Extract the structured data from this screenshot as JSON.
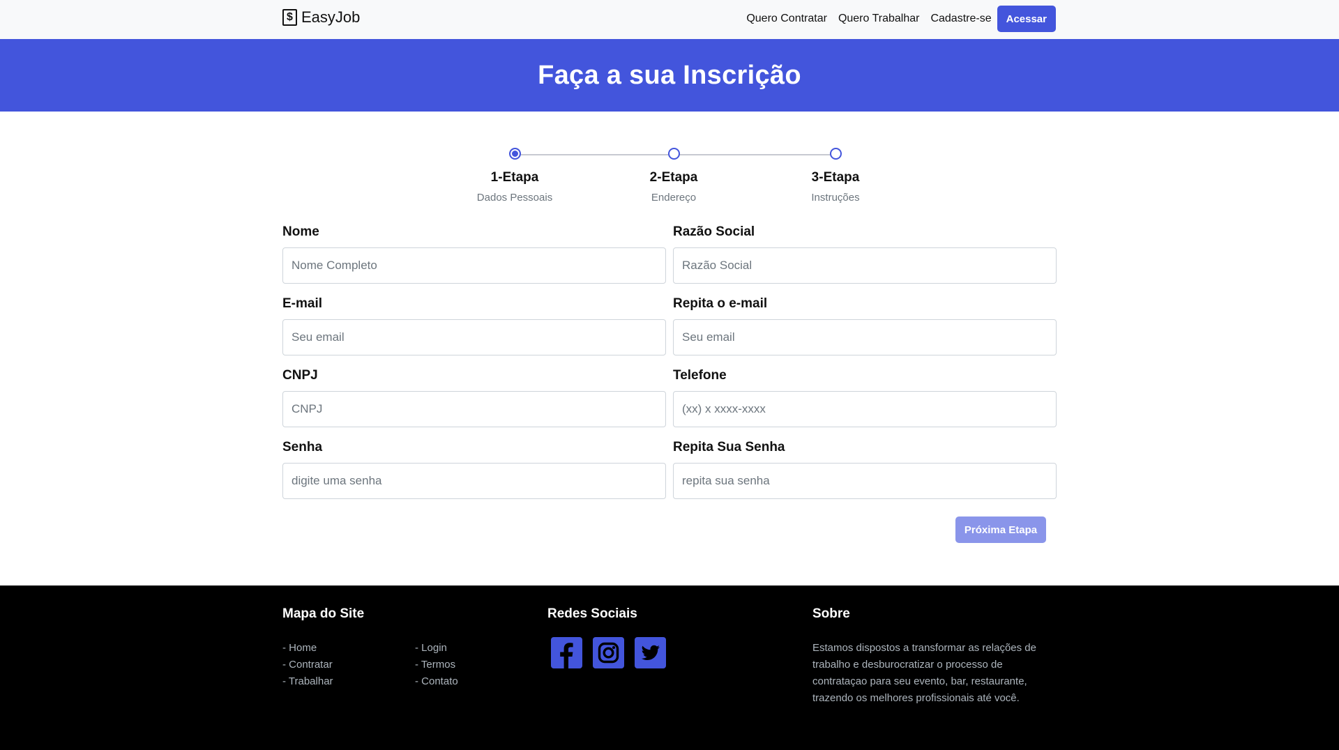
{
  "navbar": {
    "brand_icon": "$",
    "brand": "EasyJob",
    "links": [
      "Quero Contratar",
      "Quero Trabalhar",
      "Cadastre-se"
    ],
    "button": "Acessar"
  },
  "hero": {
    "title": "Faça a sua Inscrição"
  },
  "stepper": {
    "steps": [
      {
        "title": "1-Etapa",
        "subtitle": "Dados Pessoais",
        "active": true
      },
      {
        "title": "2-Etapa",
        "subtitle": "Endereço",
        "active": false
      },
      {
        "title": "3-Etapa",
        "subtitle": "Instruções",
        "active": false
      }
    ]
  },
  "form": {
    "fields": [
      {
        "label": "Nome",
        "placeholder": "Nome Completo",
        "value": ""
      },
      {
        "label": "Razão Social",
        "placeholder": "Razão Social",
        "value": ""
      },
      {
        "label": "E-mail",
        "placeholder": "Seu email",
        "value": ""
      },
      {
        "label": "Repita o e-mail",
        "placeholder": "Seu email",
        "value": ""
      },
      {
        "label": "CNPJ",
        "placeholder": "CNPJ",
        "value": ""
      },
      {
        "label": "Telefone",
        "placeholder": "(xx) x xxxx-xxxx",
        "value": ""
      },
      {
        "label": "Senha",
        "placeholder": "digite uma senha",
        "value": ""
      },
      {
        "label": "Repita Sua Senha",
        "placeholder": "repita sua senha",
        "value": ""
      }
    ],
    "next_button": "Próxima Etapa"
  },
  "footer": {
    "site_map": {
      "title": "Mapa do Site",
      "col1": [
        "- Home",
        "- Contratar",
        "- Trabalhar"
      ],
      "col2": [
        "- Login",
        "- Termos",
        "- Contato"
      ]
    },
    "social": {
      "title": "Redes Sociais",
      "icons": [
        "facebook-icon",
        "instagram-icon",
        "twitter-icon"
      ]
    },
    "about": {
      "title": "Sobre",
      "text": "Estamos dispostos a transformar as relações de trabalho e desburocratizar o processo de contrataçao para seu evento, bar, restaurante, trazendo os melhores profissionais até você."
    }
  },
  "colors": {
    "primary": "#4355dc",
    "primary_disabled": "#8a95ea",
    "footer_bg": "#000000",
    "navbar_bg": "#f8f9fa"
  }
}
